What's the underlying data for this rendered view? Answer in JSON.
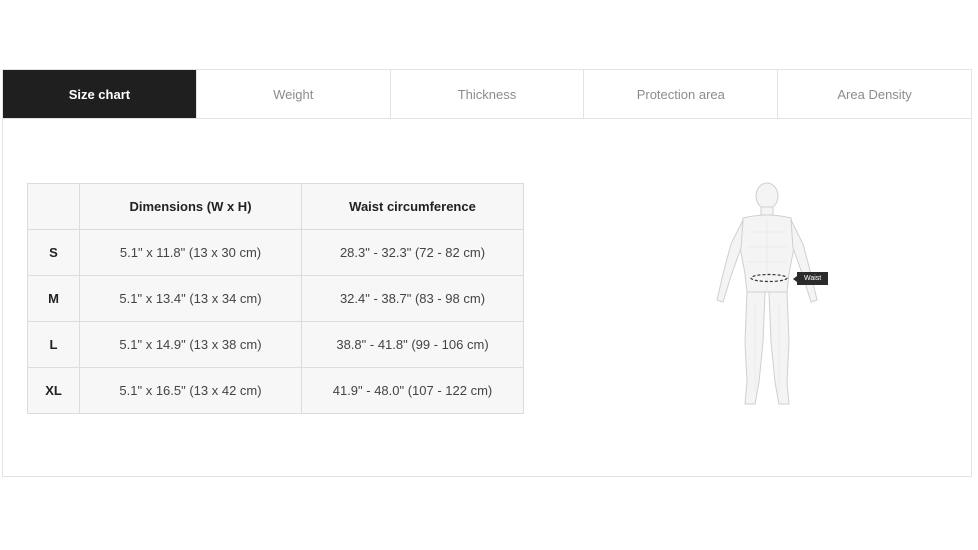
{
  "tabs": [
    {
      "label": "Size chart",
      "active": true
    },
    {
      "label": "Weight",
      "active": false
    },
    {
      "label": "Thickness",
      "active": false
    },
    {
      "label": "Protection area",
      "active": false
    },
    {
      "label": "Area Density",
      "active": false
    }
  ],
  "size_table": {
    "headers": [
      "",
      "Dimensions (W x H)",
      "Waist circumference"
    ],
    "rows": [
      {
        "size": "S",
        "dimensions": "5.1\" x 11.8\" (13 x 30 cm)",
        "waist": "28.3\" - 32.3\" (72 - 82 cm)"
      },
      {
        "size": "M",
        "dimensions": "5.1\" x 13.4\" (13 x 34 cm)",
        "waist": "32.4\" - 38.7\" (83 - 98 cm)"
      },
      {
        "size": "L",
        "dimensions": "5.1\" x 14.9\" (13 x 38 cm)",
        "waist": "38.8\" - 41.8\" (99 - 106 cm)"
      },
      {
        "size": "XL",
        "dimensions": "5.1\" x 16.5\" (13 x 42 cm)",
        "waist": "41.9\" - 48.0\" (107 - 122 cm)"
      }
    ]
  },
  "figure": {
    "waist_label": "Waist"
  }
}
